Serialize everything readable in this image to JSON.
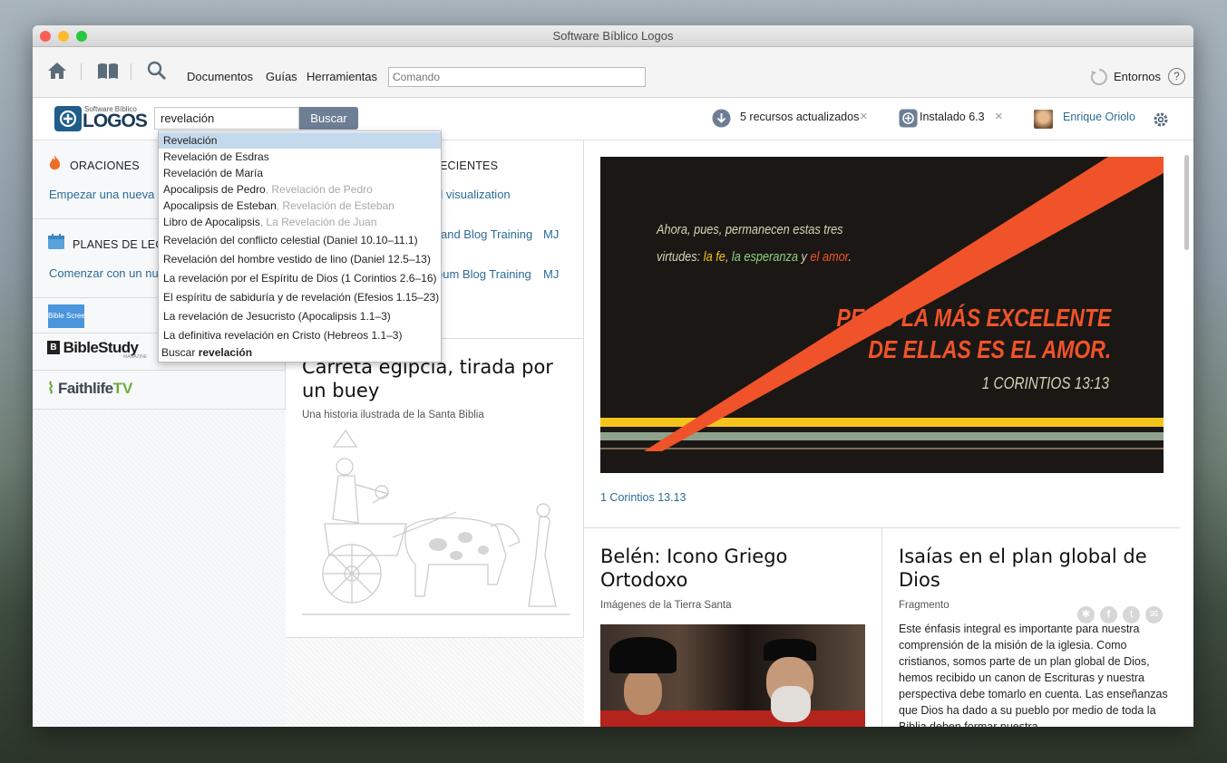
{
  "window": {
    "title": "Software Bíblico Logos"
  },
  "toolbar": {
    "menu": [
      "Documentos",
      "Guías",
      "Herramientas"
    ],
    "command_placeholder": "Comando",
    "layouts_label": "Entornos",
    "help": "?"
  },
  "header": {
    "logo_small": "Software Bíblico",
    "logo_big": "LOGOS",
    "search_value": "revelación",
    "search_button": "Buscar",
    "notif_updates": "5 recursos actualizados",
    "notif_installed": "Instalado 6.3",
    "close": "×",
    "user_name": "Enrique Oriolo"
  },
  "left": {
    "prayers_title": "ORACIONES",
    "prayers_link": "Empezar una nueva",
    "reading_title": "PLANES DE LECT",
    "reading_link": "Comenzar con un nu",
    "brands": [
      "Bible Screen",
      "BibleStudy",
      "MAGAZINE",
      "Faithlife",
      "TV"
    ]
  },
  "mid": {
    "recent_title": "ECIENTES",
    "recent_items": [
      {
        "text": "d visualization",
        "initials": ""
      },
      {
        "text": "and Blog Training",
        "initials": "MJ"
      },
      {
        "text": "bum Blog Training",
        "initials": "MJ"
      }
    ],
    "card_title": "Carreta egipcia, tirada por un buey",
    "card_subtitle": "Una historia ilustrada de la Santa Biblia"
  },
  "verse_card": {
    "line1": "Ahora, pues, permanecen estas tres",
    "line2_a": "virtudes: ",
    "line2_b": "la fe",
    "line2_c": ", ",
    "line2_d": "la esperanza",
    "line2_e": " y ",
    "line2_f": "el amor",
    "line2_g": ".",
    "big1": "PERO LA MÁS EXCELENTE",
    "big2": "DE ELLAS ES EL AMOR.",
    "ref": "1 CORINTIOS 13:13",
    "link": "1 Corintios 13.13"
  },
  "cards": [
    {
      "title": "Belén: Icono Griego Ortodoxo",
      "subtitle": "Imágenes de la Tierra Santa"
    },
    {
      "title": "Isaías en el plan global de Dios",
      "subtitle": "Fragmento",
      "body": "Este énfasis integral es importante para nuestra comprensión de la misión de la iglesia. Como cristianos, somos parte de un plan global de Dios, hemos recibido un canon de Escrituras y nuestra perspectiva debe tomarlo en cuenta. Las enseñanzas que Dios ha dado a su pueblo por medio de toda la Biblia deben formar nuestra"
    }
  ],
  "dropdown": {
    "items": [
      {
        "text": "Revelación",
        "alt": ""
      },
      {
        "text": "Revelación de Esdras",
        "alt": ""
      },
      {
        "text": "Revelación de María",
        "alt": ""
      },
      {
        "text": "Apocalipsis de Pedro",
        "alt": ", Revelación de Pedro"
      },
      {
        "text": "Apocalipsis de Esteban",
        "alt": ", Revelación de Esteban"
      },
      {
        "text": "Libro de Apocalipsis",
        "alt": ", La Revelación de Juan"
      },
      {
        "text": "Revelación del conflicto celestial (Daniel 10.10–11.1)",
        "alt": ""
      },
      {
        "text": "Revelación del hombre vestido de lino (Daniel 12.5–13)",
        "alt": ""
      },
      {
        "text": "La revelación por el Espíritu de Dios (1 Corintios 2.6–16)",
        "alt": ""
      },
      {
        "text": "El espíritu de sabiduría y de revelación (Efesios 1.15–23)",
        "alt": ""
      },
      {
        "text": "La revelación de Jesucristo (Apocalipsis 1.1–3)",
        "alt": ""
      },
      {
        "text": "La definitiva revelación en Cristo (Hebreos 1.1–3)",
        "alt": ""
      }
    ],
    "search_prefix": "Buscar ",
    "search_term": "revelación"
  },
  "colors": {
    "accent": "#2b6c98",
    "highlight": "#c5d9ec",
    "poster_orange": "#f0532a",
    "poster_yellow": "#f3c51c"
  }
}
